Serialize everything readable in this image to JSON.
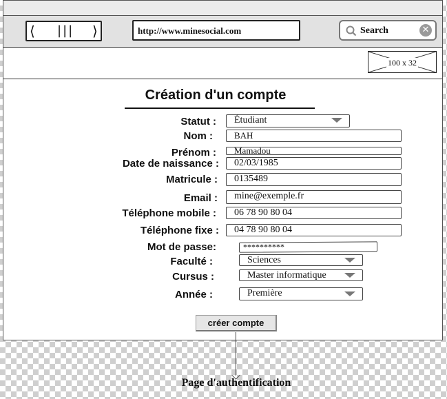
{
  "browser": {
    "url": "http://www.minesocial.com",
    "search_placeholder": "Search",
    "nav_glyphs": {
      "back": "⟨",
      "menu": "|||",
      "forward": "⟩"
    },
    "placeholder_image_label": "100 x 32"
  },
  "form": {
    "title": "Création d'un compte",
    "fields": {
      "statut": {
        "label": "Statut :",
        "value": "Étudiant"
      },
      "nom": {
        "label": "Nom :",
        "value": "BAH"
      },
      "prenom": {
        "label": "Prénom :",
        "value": "Mamadou"
      },
      "naissance": {
        "label": "Date de naissance :",
        "value": "02/03/1985"
      },
      "matricule": {
        "label": "Matricule :",
        "value": "0135489"
      },
      "email": {
        "label": "Email :",
        "value": "mine@exemple.fr"
      },
      "tel_mobile": {
        "label": "Téléphone mobile :",
        "value": "06 78 90 80 04"
      },
      "tel_fixe": {
        "label": "Téléphone fixe :",
        "value": "04 78 90 80 04"
      },
      "mot_de_passe": {
        "label": "Mot de passe:",
        "value": "**********"
      },
      "faculte": {
        "label": "Faculté :",
        "value": "Sciences"
      },
      "cursus": {
        "label": "Cursus :",
        "value": "Master informatique"
      },
      "annee": {
        "label": "Année :",
        "value": "Première"
      }
    },
    "submit_label": "créer compte"
  },
  "flow": {
    "target_label": "Page d'authentification"
  },
  "icons": {
    "search": "search-icon",
    "clear": "close-icon",
    "image_placeholder": "image-placeholder-icon"
  }
}
